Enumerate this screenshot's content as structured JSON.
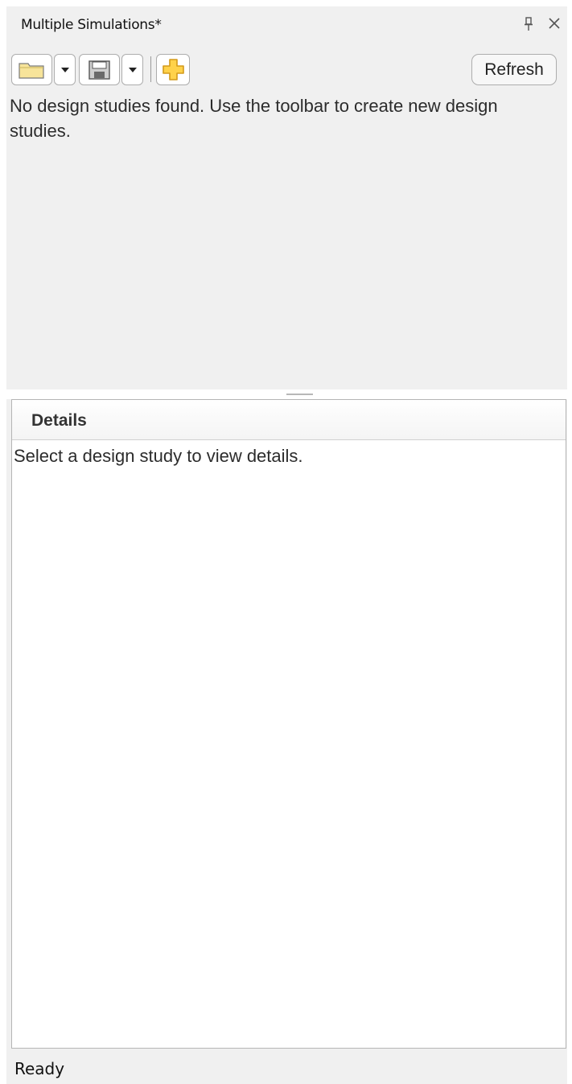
{
  "panel": {
    "title": "Multiple Simulations*",
    "pin_icon": "pin-icon",
    "close_icon": "close-icon"
  },
  "toolbar": {
    "open_icon": "folder-icon",
    "save_icon": "floppy-disk-icon",
    "new_icon": "plus-icon",
    "refresh_label": "Refresh"
  },
  "main": {
    "empty_message": "No design studies found. Use the toolbar to create new design studies."
  },
  "details": {
    "title": "Details",
    "message": "Select a design study to view details."
  },
  "status": {
    "text": "Ready"
  },
  "colors": {
    "panel_background": "#f0f0f0",
    "folder_fill": "#f7e49a",
    "plus_fill": "#ffd24a",
    "plus_outline": "#d49a1a"
  }
}
